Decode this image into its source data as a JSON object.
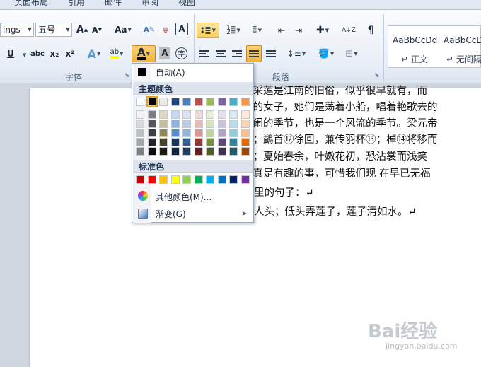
{
  "tabs": [
    "页面布局",
    "引用",
    "邮件",
    "审阅",
    "视图"
  ],
  "font": {
    "name": "ings",
    "size": "五号",
    "grow_glyph": "A",
    "shrink_glyph": "A",
    "case_glyph": "Aa",
    "underline_glyph": "U",
    "strike_glyph": "abc",
    "sub_glyph": "x₂",
    "sup_glyph": "x²",
    "effects_glyph": "A",
    "highlight_glyph": "ab",
    "fontcolor_glyph": "A",
    "shading_glyph": "A",
    "enclose_glyph": "字",
    "clear_glyph": "wén",
    "phonetic_glyph": "变",
    "border_glyph": "A",
    "group_label": "字体"
  },
  "paragraph": {
    "group_label": "段落",
    "sort_glyph": "A↓Z"
  },
  "styles": {
    "items": [
      {
        "sample": "AaBbCcDd",
        "name": "正文"
      },
      {
        "sample": "AaBbCcDd",
        "name": "无间隔"
      }
    ]
  },
  "colors": {
    "accent": "#f0b43a",
    "header_bg": "#dde3ec",
    "font_color_bar": "#000000"
  },
  "color_menu": {
    "auto_label": "自动(A)",
    "auto_color": "#000000",
    "theme_header": "主题颜色",
    "theme_top": [
      "#ffffff",
      "#000000",
      "#eeece1",
      "#1f497d",
      "#4f81bd",
      "#c0504d",
      "#9bbb59",
      "#8064a2",
      "#4bacc6",
      "#f79646"
    ],
    "theme_shades": [
      [
        "#f2f2f2",
        "#d8d8d8",
        "#bfbfbf",
        "#a5a5a5",
        "#7f7f7f"
      ],
      [
        "#7f7f7f",
        "#595959",
        "#3f3f3f",
        "#262626",
        "#0c0c0c"
      ],
      [
        "#ddd9c3",
        "#c4bd97",
        "#938953",
        "#494429",
        "#1d1b10"
      ],
      [
        "#c6d9f0",
        "#8db3e2",
        "#548dd4",
        "#17365d",
        "#0f243e"
      ],
      [
        "#dbe5f1",
        "#b8cce4",
        "#95b3d7",
        "#366092",
        "#244061"
      ],
      [
        "#f2dcdb",
        "#e5b9b7",
        "#d99694",
        "#953734",
        "#632423"
      ],
      [
        "#ebf1dd",
        "#d7e3bc",
        "#c3d69b",
        "#76923c",
        "#4f6128"
      ],
      [
        "#e5e0ec",
        "#ccc1d9",
        "#b2a2c7",
        "#5f497a",
        "#3f3151"
      ],
      [
        "#dbeef3",
        "#b7dde8",
        "#92cddc",
        "#31859b",
        "#205867"
      ],
      [
        "#fdeada",
        "#fbd5b5",
        "#fac08f",
        "#e36c09",
        "#974806"
      ]
    ],
    "standard_header": "标准色",
    "standard": [
      "#c00000",
      "#ff0000",
      "#ffc000",
      "#ffff00",
      "#92d050",
      "#00b050",
      "#00b0f0",
      "#0070c0",
      "#002060",
      "#7030a0"
    ],
    "more_label": "其他颜色(M)...",
    "gradient_label": "渐变(G)"
  },
  "document": {
    "lines": [
      "家子，采莲是江南的旧俗，似乎很早就有，而",
      "是少年的女子，她们是荡着小船，唱着艳歌去的",
      "一个热闹的季节，也是一个风流的季节。梁元帝",
      "待心许；鷁首⑫徐回，兼传羽杯⑬；棹⑭将移而",
      "频步⑯；夏始春余，叶嫩花初，恐沾裳而浅笑",
      "了。这真是有趣的事，可惜我们现 在早已无福",
      "曲》里的句子：↵",
      "花过人头；低头弄莲子，莲子清如水。↵"
    ]
  },
  "watermark": {
    "brand": "Bai经验",
    "url": "jingyan.baidu.com"
  }
}
